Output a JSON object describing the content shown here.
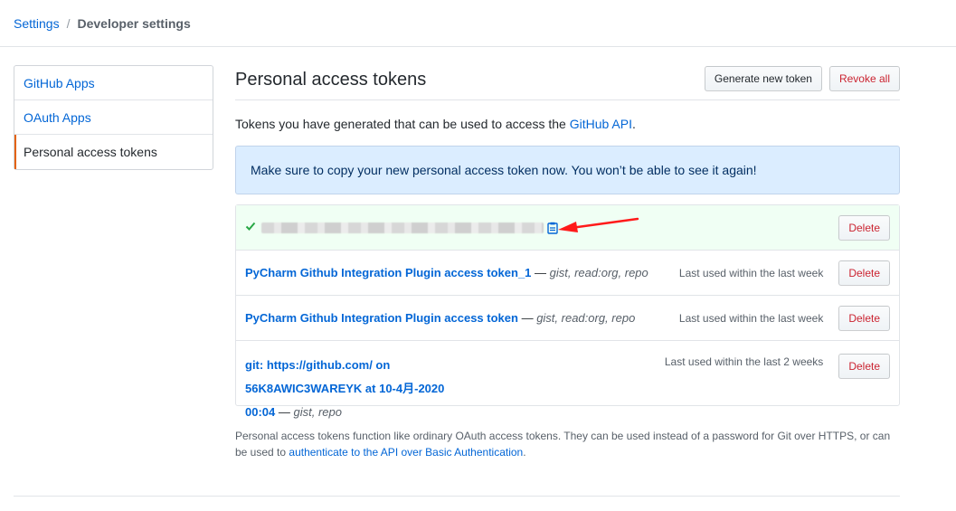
{
  "breadcrumb": {
    "parent": "Settings",
    "separator": "/",
    "current": "Developer settings"
  },
  "sidebar": {
    "items": [
      {
        "label": "GitHub Apps"
      },
      {
        "label": "OAuth Apps"
      },
      {
        "label": "Personal access tokens",
        "selected": true
      }
    ]
  },
  "main": {
    "title": "Personal access tokens",
    "generate_label": "Generate new token",
    "revoke_label": "Revoke all",
    "intro_prefix": "Tokens you have generated that can be used to access the ",
    "intro_link": "GitHub API",
    "intro_suffix": ".",
    "flash": "Make sure to copy your new personal access token now. You won’t be able to see it again!"
  },
  "tokens": {
    "new_token": {
      "delete_label": "Delete",
      "icons": [
        "check-icon",
        "clipboard-icon"
      ]
    },
    "rows": [
      {
        "name": "PyCharm Github Integration Plugin access token_1",
        "dash": " — ",
        "scopes": "gist, read:org, repo",
        "last_used": "Last used within the last week",
        "delete_label": "Delete"
      },
      {
        "name": "PyCharm Github Integration Plugin access token",
        "dash": " — ",
        "scopes": "gist, read:org, repo",
        "last_used": "Last used within the last week",
        "delete_label": "Delete"
      },
      {
        "name": "git: https://github.com/ on 56K8AWIC3WAREYK at 10-4月-2020 00:04",
        "dash": " — ",
        "scopes": "gist, repo",
        "last_used": "Last used within the last 2 weeks",
        "delete_label": "Delete"
      }
    ]
  },
  "footer": {
    "text": "Personal access tokens function like ordinary OAuth access tokens. They can be used instead of a password for Git over HTTPS, or can be used to ",
    "link": "authenticate to the API over Basic Authentication",
    "suffix": "."
  },
  "colors": {
    "link": "#0366d6",
    "danger": "#cb2431",
    "success": "#28a745",
    "flash_bg": "#dbedff",
    "new_row_bg": "#f0fff4",
    "selected_accent": "#e36209",
    "annotation_arrow": "#ff1a1a"
  }
}
